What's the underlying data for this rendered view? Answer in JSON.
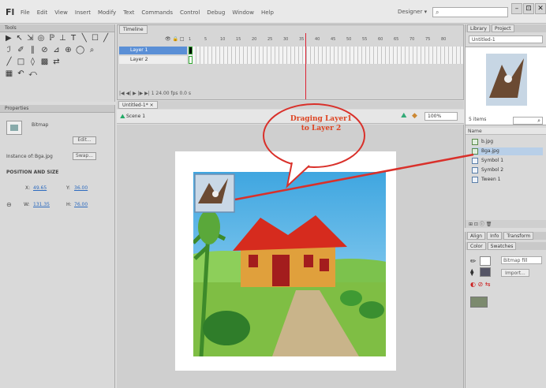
{
  "app": {
    "logo": "Fl",
    "menu": [
      "File",
      "Edit",
      "View",
      "Insert",
      "Modify",
      "Text",
      "Commands",
      "Control",
      "Debug",
      "Window",
      "Help"
    ],
    "workspace": "Designer ▾",
    "search_placeholder": "",
    "window_controls": [
      "–",
      "⊡",
      "✕"
    ]
  },
  "tools": {
    "title": "Tools",
    "rows": [
      [
        "▶",
        "↖",
        "⇲",
        "◎",
        "ℙ",
        "⊥",
        "T",
        "╲",
        "☐",
        "╱"
      ],
      [
        "ℐ",
        "✐",
        "∥",
        "⊘",
        "⊿",
        "⊕",
        "◯",
        "⌕"
      ],
      [
        "╱",
        "□",
        "◊",
        "▩",
        "⇄"
      ],
      [
        "▦",
        "↶",
        "⤺"
      ]
    ]
  },
  "properties": {
    "title": "Properties",
    "type": "Bitmap",
    "edit_btn": "Edit...",
    "instance_of_label": "Instance of:",
    "instance_of_value": "Bga.jpg",
    "swap_btn": "Swap...",
    "section": "POSITION AND SIZE",
    "x_label": "X:",
    "x": "49.65",
    "y_label": "Y:",
    "y": "36.00",
    "w_label": "W:",
    "w": "131.35",
    "h_label": "H:",
    "h": "76.00"
  },
  "timeline": {
    "tab": "Timeline",
    "frame_numbers": [
      "1",
      "5",
      "10",
      "15",
      "20",
      "25",
      "30",
      "35",
      "40",
      "45",
      "50",
      "55",
      "60",
      "65",
      "70",
      "75",
      "80"
    ],
    "layers": [
      {
        "name": "Layer 1",
        "selected": true
      },
      {
        "name": "Layer 2",
        "selected": false
      }
    ],
    "footer": "|◀ ◀| ▶ |▶ ▶|   1   24.00 fps   0.0 s"
  },
  "stage": {
    "doc_tab": "Untitled-1* ×",
    "scene": "Scene 1",
    "zoom": "100%"
  },
  "library": {
    "tabs": [
      "Library",
      "Project"
    ],
    "document": "Untitled-1",
    "count": "5 items",
    "name_header": "Name",
    "items": [
      {
        "name": "b.jpg",
        "kind": "bitmap"
      },
      {
        "name": "Bga.jpg",
        "kind": "bitmap",
        "selected": true
      },
      {
        "name": "Symbol 1",
        "kind": "symbol"
      },
      {
        "name": "Symbol 2",
        "kind": "symbol"
      },
      {
        "name": "Tween 1",
        "kind": "symbol"
      }
    ],
    "footer": "⊞ ⊡ ⓘ 🗑"
  },
  "color": {
    "tabs_top": [
      "Align",
      "Info",
      "Transform"
    ],
    "tabs": [
      "Color",
      "Swatches"
    ],
    "fill_type": "Bitmap fill",
    "import_btn": "Import..."
  },
  "annotation": {
    "text": "Draging Layer1 to Layer 2",
    "color": "#d9302a"
  },
  "colors": {
    "accent_selection": "#5a8fd6",
    "playhead": "#dd2233"
  }
}
